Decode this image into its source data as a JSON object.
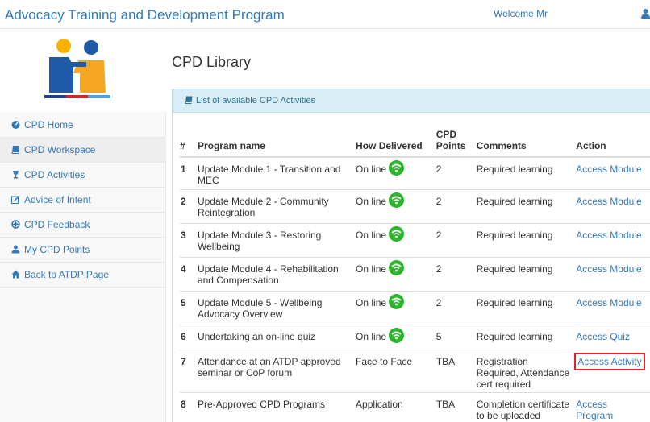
{
  "header": {
    "brand": "Advocacy Training and Development Program",
    "welcome": "Welcome Mr",
    "user_icon": "user-icon"
  },
  "sidebar": {
    "logo_icon": "two-people-logo",
    "items": [
      {
        "label": "CPD Home",
        "icon": "dashboard-icon"
      },
      {
        "label": "CPD Workspace",
        "icon": "book-icon"
      },
      {
        "label": "CPD Activities",
        "icon": "trophy-icon"
      },
      {
        "label": "Advice of Intent",
        "icon": "edit-icon"
      },
      {
        "label": "CPD Feedback",
        "icon": "lifebuoy-icon"
      },
      {
        "label": "My CPD Points",
        "icon": "user-icon"
      },
      {
        "label": "Back to ATDP Page",
        "icon": "home-icon"
      }
    ]
  },
  "main": {
    "title": "CPD Library",
    "panel_heading": "List of available CPD Activities",
    "columns": [
      "#",
      "Program name",
      "How Delivered",
      "CPD Points",
      "Comments",
      "Action"
    ],
    "rows": [
      {
        "num": "1",
        "name": "Update Module 1 - Transition and MEC",
        "delivered": "On line",
        "online": true,
        "points": "2",
        "comments": "Required learning",
        "action": "Access Module"
      },
      {
        "num": "2",
        "name": "Update Module 2 - Community Reintegration",
        "delivered": "On line",
        "online": true,
        "points": "2",
        "comments": "Required learning",
        "action": "Access Module"
      },
      {
        "num": "3",
        "name": "Update Module 3 - Restoring Wellbeing",
        "delivered": "On line",
        "online": true,
        "points": "2",
        "comments": "Required learning",
        "action": "Access Module"
      },
      {
        "num": "4",
        "name": "Update Module 4 - Rehabilitation and Compensation",
        "delivered": "On line",
        "online": true,
        "points": "2",
        "comments": "Required learning",
        "action": "Access Module"
      },
      {
        "num": "5",
        "name": "Update Module 5 - Wellbeing Advocacy Overview",
        "delivered": "On line",
        "online": true,
        "points": "2",
        "comments": "Required learning",
        "action": "Access Module"
      },
      {
        "num": "6",
        "name": "Undertaking an on-line quiz",
        "delivered": "On line",
        "online": true,
        "points": "5",
        "comments": "Required learning",
        "action": "Access Quiz"
      },
      {
        "num": "7",
        "name": "Attendance at an ATDP approved seminar or CoP forum",
        "delivered": "Face to Face",
        "online": false,
        "points": "TBA",
        "comments": "Registration Required, Attendance cert required",
        "action": "Access Activity",
        "highlighted": true
      },
      {
        "num": "8",
        "name": "Pre-Approved CPD Programs",
        "delivered": "Application",
        "online": false,
        "points": "TBA",
        "comments": "Completion certificate to be uploaded",
        "action": "Access Program"
      }
    ]
  },
  "colors": {
    "link": "#337ab7",
    "panel_bg": "#d9edf7",
    "wifi_green": "#2bb52b",
    "highlight": "#e8212b"
  }
}
